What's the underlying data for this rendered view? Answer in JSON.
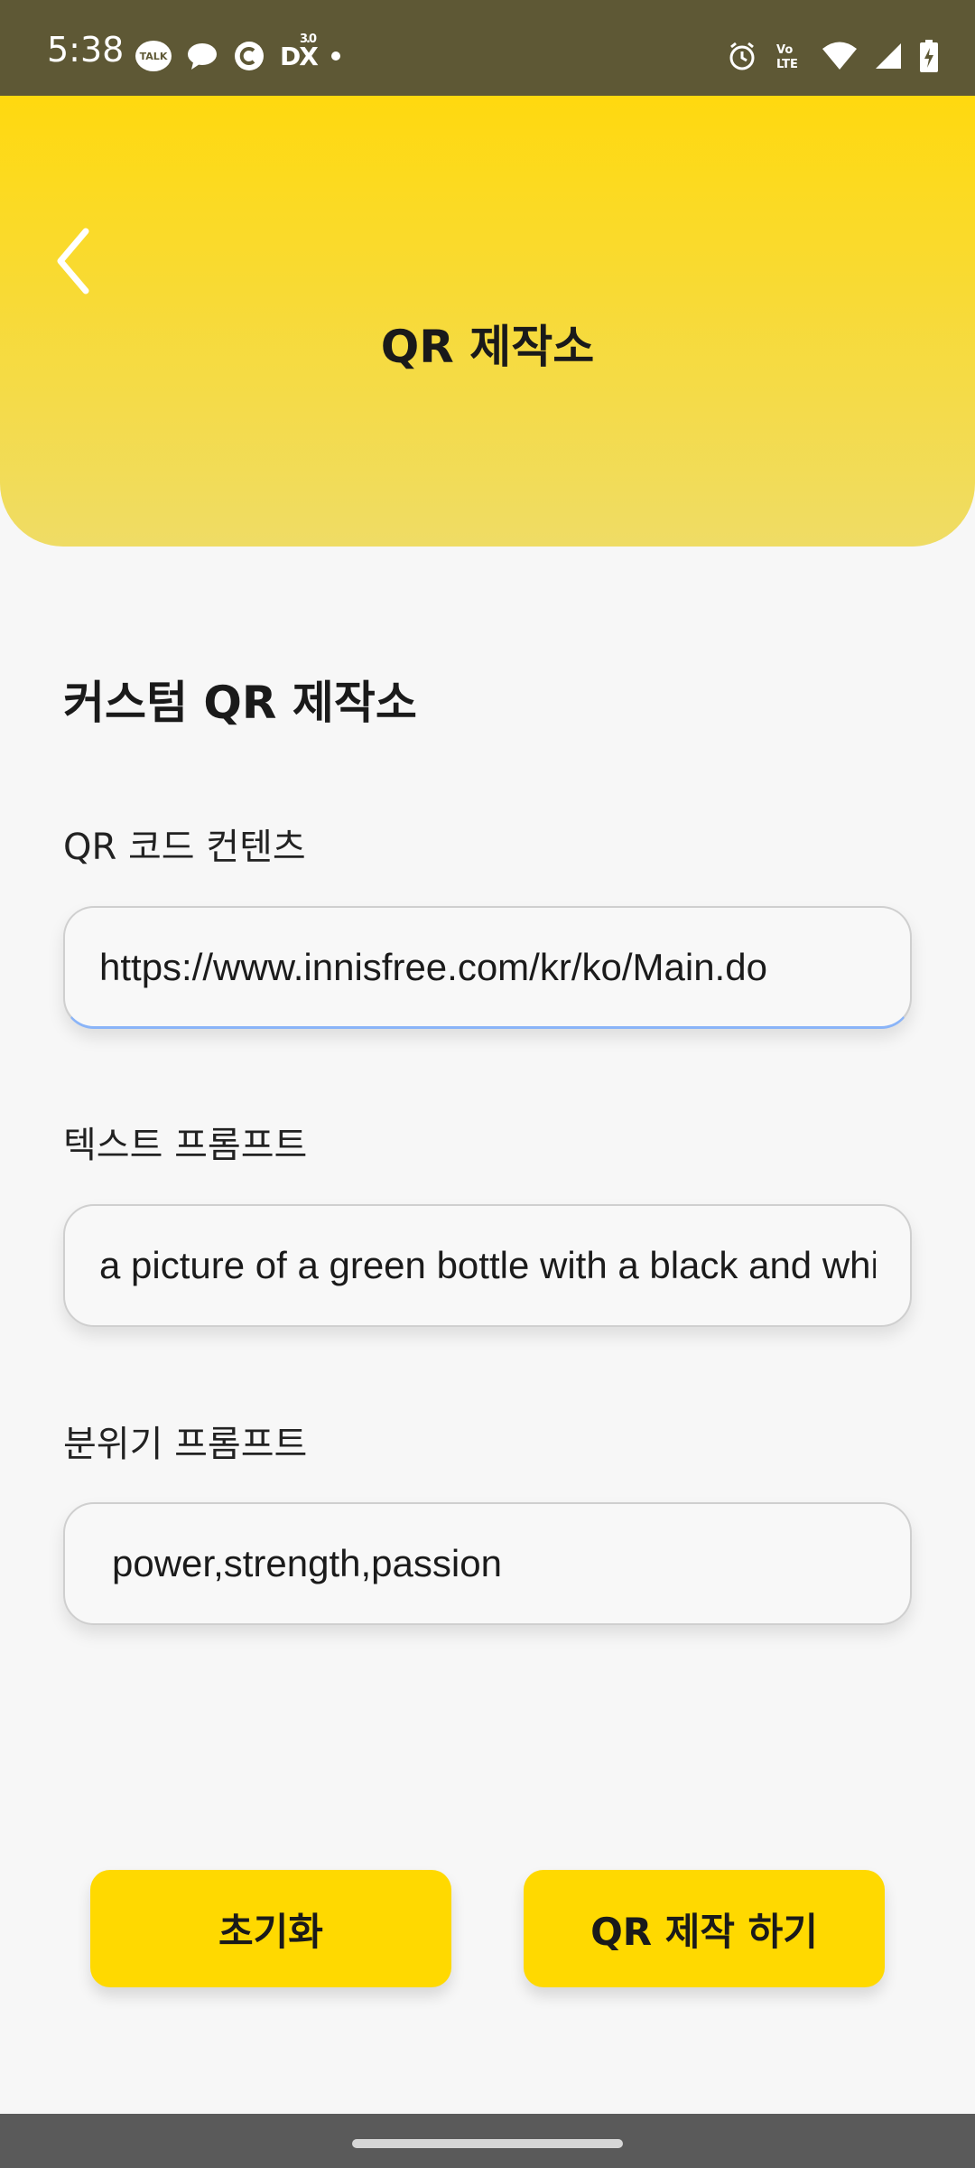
{
  "status_bar": {
    "time": "5:38",
    "talk_label": "TALK",
    "dx_label": "DX",
    "dx_version": "3.0"
  },
  "header": {
    "title": "QR 제작소"
  },
  "form": {
    "section_title": "커스텀 QR 제작소",
    "qr_content": {
      "label": "QR 코드 컨텐츠",
      "value": "https://www.innisfree.com/kr/ko/Main.do"
    },
    "text_prompt": {
      "label": "텍스트 프롬프트",
      "value": "a picture of a green bottle with a black and white label"
    },
    "mood_prompt": {
      "label": "분위기 프롬프트",
      "value": "power,strength,passion"
    }
  },
  "buttons": {
    "reset": "초기화",
    "create": "QR 제작 하기"
  },
  "colors": {
    "status_bar": "#5e5835",
    "header_top": "#ffd90f",
    "header_bottom": "#efdc65",
    "button": "#ffd900",
    "background": "#f7f7f7"
  }
}
